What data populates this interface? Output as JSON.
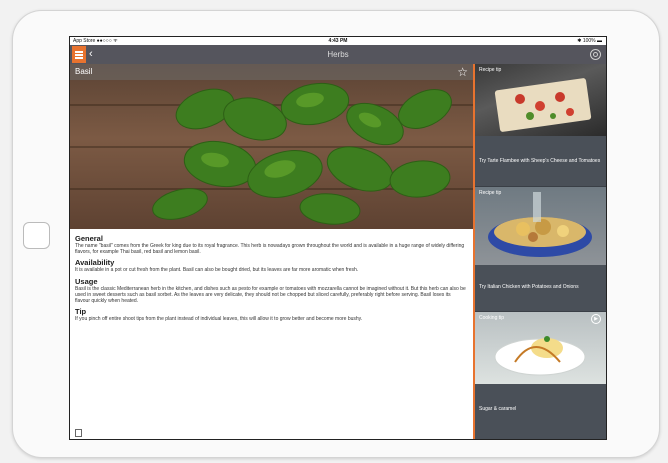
{
  "status_bar": {
    "carrier": "App Store ●●○○○ ᯤ",
    "time": "4:43 PM",
    "battery": "✱ 100% ▬"
  },
  "nav": {
    "title": "Herbs",
    "menu_icon": "hamburger-icon",
    "back_icon": "chevron-left-icon",
    "settings_icon": "gear-icon",
    "accent": "#e8732f"
  },
  "detail": {
    "title": "Basil",
    "sections": [
      {
        "heading": "General",
        "body": "The name \"basil\" comes from the Greek for king due to its royal fragrance. This herb is nowadays grown throughout the world and is available in a huge range of widely differing flavors, for example Thai basil, red basil and lemon basil."
      },
      {
        "heading": "Availability",
        "body": "It is available in a pot or cut fresh from the plant. Basil can also be bought dried, but its leaves are far more aromatic when fresh."
      },
      {
        "heading": "Usage",
        "body": "Basil is the classic Mediterranean herb in the kitchen, and dishes such as pesto for example or tomatoes with mozzarella cannot be imagined without it. But this herb can also be used in sweet desserts such as basil sorbet. As the leaves are very delicate, they should not be chopped but sliced carefully, preferably right before serving. Basil loses its flavour quickly when heated."
      },
      {
        "heading": "Tip",
        "body": "If you pinch off entire shoot tips from the plant instead of individual leaves, this will allow it to grow better and become more bushy."
      }
    ]
  },
  "tips": [
    {
      "label": "Recipe tip",
      "title": "Try Tarte Flambee with Sheep's Cheese and Tomatoes"
    },
    {
      "label": "Recipe tip",
      "title": "Try Italian Chicken with Potatoes and Onions"
    },
    {
      "label": "Cooking tip",
      "title": "Sugar & caramel"
    }
  ]
}
